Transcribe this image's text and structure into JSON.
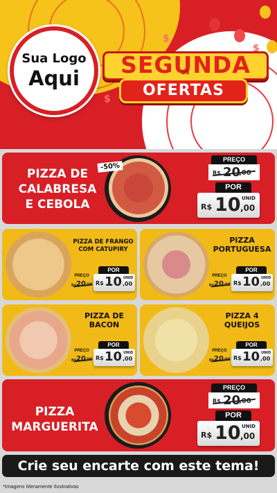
{
  "logo": {
    "line1": "Sua Logo",
    "line2": "Aqui"
  },
  "campaign": {
    "word1": "SEGUNDA",
    "de": "DE",
    "word2": "OFERTAS"
  },
  "offers": [
    {
      "name_lines": [
        "PIZZA DE",
        "CALABRESA",
        "E CEBOLA"
      ],
      "badge": "-50%",
      "preco_label": "PREÇO",
      "old_prefix": "R$",
      "old_int": "20",
      "old_cents": ",00",
      "por_label": "POR",
      "new_prefix": "R$",
      "new_int": "10",
      "new_cents": ",00",
      "unit": "UNID"
    },
    {
      "name_lines": [
        "PIZZA DE FRANGO",
        "COM CATUPIRY"
      ],
      "preco_label": "PREÇO",
      "old_prefix": "R$",
      "old_int": "20",
      "old_cents": ",00",
      "por_label": "POR",
      "new_prefix": "R$",
      "new_int": "10",
      "new_cents": ",00",
      "unit": "UNID"
    },
    {
      "name_lines": [
        "PIZZA",
        "PORTUGUESA"
      ],
      "preco_label": "PREÇO",
      "old_prefix": "R$",
      "old_int": "20",
      "old_cents": ",00",
      "por_label": "POR",
      "new_prefix": "R$",
      "new_int": "10",
      "new_cents": ",00",
      "unit": "UNID"
    },
    {
      "name_lines": [
        "PIZZA DE",
        "BACON"
      ],
      "preco_label": "PREÇO",
      "old_prefix": "R$",
      "old_int": "20",
      "old_cents": ",00",
      "por_label": "POR",
      "new_prefix": "R$",
      "new_int": "10",
      "new_cents": ",00",
      "unit": "UNID"
    },
    {
      "name_lines": [
        "PIZZA 4",
        "QUEIJOS"
      ],
      "preco_label": "PREÇO",
      "old_prefix": "R$",
      "old_int": "20",
      "old_cents": ",00",
      "por_label": "POR",
      "new_prefix": "R$",
      "new_int": "10",
      "new_cents": ",00",
      "unit": "UNID"
    },
    {
      "name_lines": [
        "PIZZA",
        "MARGUERITA"
      ],
      "preco_label": "PREÇO",
      "old_prefix": "R$",
      "old_int": "20",
      "old_cents": ",00",
      "por_label": "POR",
      "new_prefix": "R$",
      "new_int": "10",
      "new_cents": ",00",
      "unit": "UNID"
    }
  ],
  "cta": "Crie seu encarte com este tema!",
  "disclaimer": "*Imagens Meramente Ilustrativas",
  "colors": {
    "red": "#d81f26",
    "yellow": "#f1ba16",
    "black": "#111111"
  }
}
